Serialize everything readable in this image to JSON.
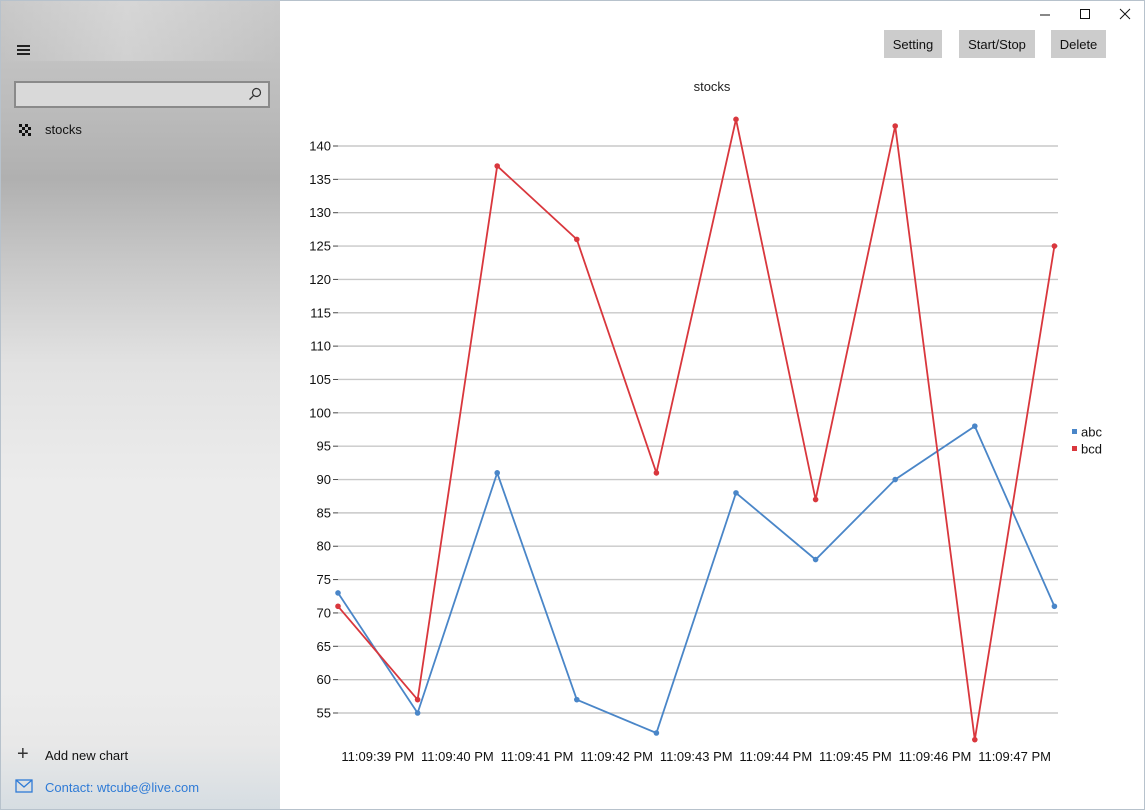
{
  "sidebar": {
    "search": {
      "value": "",
      "placeholder": ""
    },
    "items": [
      {
        "label": "stocks",
        "icon": "chart-grid-icon"
      }
    ],
    "add_chart_label": "Add new chart",
    "contact_label": "Contact: wtcube@live.com"
  },
  "toolbar": {
    "setting_label": "Setting",
    "startstop_label": "Start/Stop",
    "delete_label": "Delete"
  },
  "window_controls": [
    "minimize-icon",
    "maximize-icon",
    "close-icon"
  ],
  "colors": {
    "abc": "#4a86c8",
    "bcd": "#d9373d",
    "gridline": "#c8c8c8",
    "contact_link": "#2f7bd6",
    "button_bg": "#cccccc"
  },
  "chart_data": {
    "type": "line",
    "title": "stocks",
    "xlabel": "",
    "ylabel": "",
    "categories": [
      "11:09:39 PM",
      "11:09:40 PM",
      "11:09:41 PM",
      "11:09:42 PM",
      "11:09:43 PM",
      "11:09:44 PM",
      "11:09:45 PM",
      "11:09:46 PM",
      "11:09:47 PM"
    ],
    "x_points": [
      0,
      1,
      2,
      3,
      4,
      5,
      6,
      7,
      8,
      9
    ],
    "yticks": [
      55,
      60,
      65,
      70,
      75,
      80,
      85,
      90,
      95,
      100,
      105,
      110,
      115,
      120,
      125,
      130,
      135,
      140
    ],
    "ylim": [
      50,
      144
    ],
    "grid": true,
    "legend_position": "right",
    "series": [
      {
        "name": "abc",
        "values": [
          73,
          55,
          91,
          57,
          52,
          88,
          78,
          90,
          98,
          71
        ]
      },
      {
        "name": "bcd",
        "values": [
          71,
          57,
          137,
          126,
          91,
          144,
          87,
          143,
          51,
          125
        ]
      }
    ]
  }
}
